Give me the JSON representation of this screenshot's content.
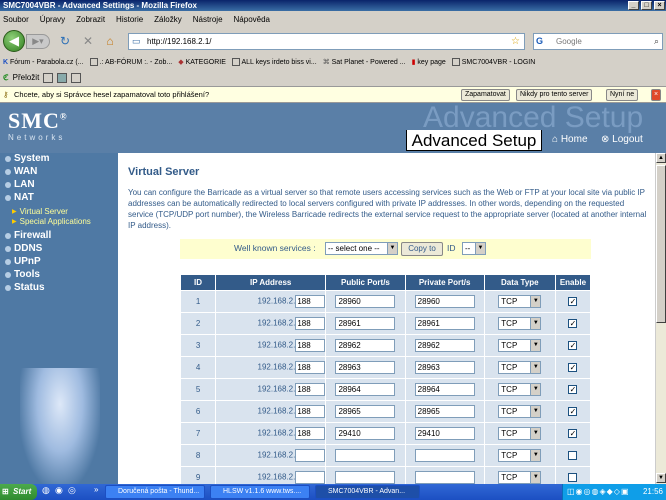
{
  "window": {
    "title": "SMC7004VBR - Advanced Settings - Mozilla Firefox",
    "controls": [
      "_",
      "□",
      "×"
    ]
  },
  "menu": [
    "Soubor",
    "Úpravy",
    "Zobrazit",
    "Historie",
    "Záložky",
    "Nástroje",
    "Nápověda"
  ],
  "nav": {
    "url": "http://192.168.2.1/",
    "search_placeholder": "Google"
  },
  "bookmarks": [
    "Fórum - Parabola.cz (...",
    ".: AB-FÓRUM :. - Zob...",
    "KATEGORIE",
    "ALL keys irdeto biss vi...",
    "Sat Planet - Powered ...",
    "key page",
    "SMC7004VBR - LOGIN"
  ],
  "bookmarks2": [
    "Přeložit"
  ],
  "notification": {
    "text": "Chcete, aby si Správce hesel zapamatoval toto přihlášení?",
    "remember": "Zapamatovat",
    "never": "Nikdy pro tento server",
    "not_now": "Nyní ne"
  },
  "header": {
    "logo": "SMC",
    "logo_sub": "Networks",
    "watermark": "Advanced Setup",
    "title": "Advanced Setup",
    "home": "Home",
    "logout": "Logout"
  },
  "sidebar": {
    "items": [
      "System",
      "WAN",
      "LAN",
      "NAT"
    ],
    "subitems": [
      "Virtual Server",
      "Special Applications"
    ],
    "items2": [
      "Firewall",
      "DDNS",
      "UPnP",
      "Tools",
      "Status"
    ]
  },
  "content": {
    "title": "Virtual Server",
    "description": "You can configure the Barricade as a virtual server so that remote users accessing services such as the Web or FTP at your local site via public IP addresses can be automatically redirected to local servers configured with private IP addresses. In other words, depending on the requested service (TCP/UDP port number), the Wireless Barricade redirects the external service request to the appropriate server (located at another internal IP address).",
    "well_known_label": "Well known services :",
    "service_select": "-- select one --",
    "copy_button": "Copy to",
    "id_label": "ID",
    "id_select": "--",
    "columns": [
      "ID",
      "IP Address",
      "Public Port/s",
      "Private Port/s",
      "Data Type",
      "Enable"
    ],
    "ip_prefix": "192.168.2.",
    "rows": [
      {
        "id": "1",
        "ip": "188",
        "public": "28960",
        "private": "28960",
        "type": "TCP",
        "enabled": true
      },
      {
        "id": "2",
        "ip": "188",
        "public": "28961",
        "private": "28961",
        "type": "TCP",
        "enabled": true
      },
      {
        "id": "3",
        "ip": "188",
        "public": "28962",
        "private": "28962",
        "type": "TCP",
        "enabled": true
      },
      {
        "id": "4",
        "ip": "188",
        "public": "28963",
        "private": "28963",
        "type": "TCP",
        "enabled": true
      },
      {
        "id": "5",
        "ip": "188",
        "public": "28964",
        "private": "28964",
        "type": "TCP",
        "enabled": true
      },
      {
        "id": "6",
        "ip": "188",
        "public": "28965",
        "private": "28965",
        "type": "TCP",
        "enabled": true
      },
      {
        "id": "7",
        "ip": "188",
        "public": "29410",
        "private": "29410",
        "type": "TCP",
        "enabled": true
      },
      {
        "id": "8",
        "ip": "",
        "public": "",
        "private": "",
        "type": "TCP",
        "enabled": false
      },
      {
        "id": "9",
        "ip": "",
        "public": "",
        "private": "",
        "type": "TCP",
        "enabled": false
      }
    ]
  },
  "taskbar": {
    "start": "Start",
    "tasks": [
      "Doručená pošta - Thund...",
      "HLSW v1.1.6  www.tws....",
      "SMC7004VBR - Advan..."
    ],
    "clock": "21:56"
  }
}
